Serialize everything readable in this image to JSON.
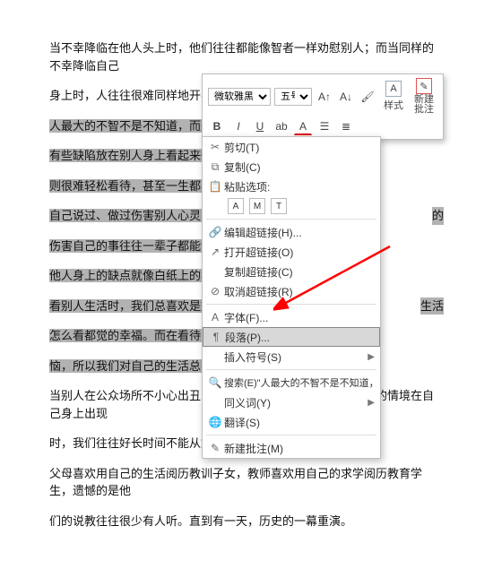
{
  "page": {
    "para1": "当不幸降临在他人头上时，他们往往都能像智者一样劝慰别人；而当同样的不幸降临自己",
    "para1b": "身上时，人往往很难同样地开导自己。",
    "para2a": "人最大的不智不是不知道，而是知道",
    "para3a": "有些缺陷放在别人身上看起来微不足",
    "para3b": "则很难轻松看待，甚至一生都不能释",
    "para4a": "自己说过、做过伤害别人心灵的事，有",
    "para4a_tail": "的",
    "para4b": "伤害自己的事往往一辈子都能记得清",
    "para5": "他人身上的缺点就像白纸上的黑点，",
    "para6a": "看别人生活时，我们总喜欢是放大他",
    "para6a_tail": "生活",
    "para6b": "怎么看都觉的幸福。而在看待自己生",
    "para6c": "恼，所以我们对自己的生活总有太多的",
    "para7a": "当别人在公众场所不小心出丑时，我们往往一笑了之；而当同样的情境在自己身上出现",
    "para7b": "时，我们往往好长时间不能从尴尬中走出来。",
    "para8a": "父母喜欢用自己的生活阅历教训子女，教师喜欢用自己的求学阅历教育学生，遗憾的是他",
    "para8b": "们的说教往往很少有人听。直到有一天，历史的一幕重演。"
  },
  "toolbar": {
    "font_name": "微软雅黑",
    "font_size": "五号",
    "bold": "B",
    "italic": "I",
    "underline": "U",
    "styles": "样式",
    "new_comment": "新建\n批注"
  },
  "ctx": {
    "cut": "剪切(T)",
    "copy": "复制(C)",
    "paste_label": "粘贴选项:",
    "edit_link": "编辑超链接(H)...",
    "open_link": "打开超链接(O)",
    "copy_link": "复制超链接(C)",
    "remove_link": "取消超链接(R)",
    "font": "字体(F)...",
    "paragraph": "段落(P)...",
    "symbol": "插入符号(S)",
    "search": "搜索(E)\"人最大的不智不是不知道，而是知…\"",
    "synonym": "同义词(Y)",
    "translate": "翻译(S)",
    "new_comment": "新建批注(M)"
  }
}
